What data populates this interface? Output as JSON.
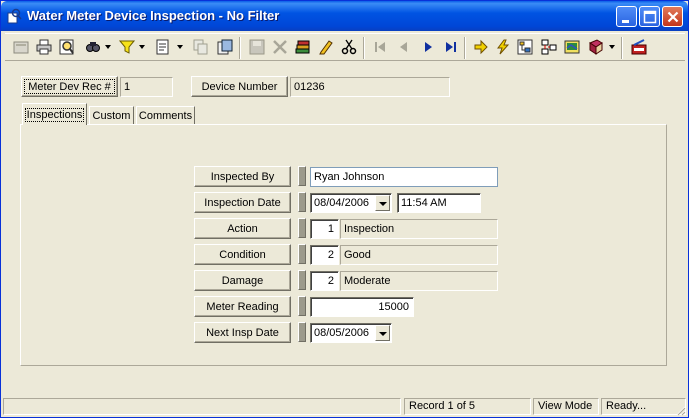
{
  "window": {
    "title": "Water Meter Device Inspection - No Filter"
  },
  "toolbar": {
    "icons": [
      "new-record-icon",
      "print-icon",
      "print-preview-icon",
      "find-icon",
      "filter-icon",
      "report-icon",
      "copy-icon",
      "paste-icon",
      "save-icon",
      "delete-icon",
      "stack-icon",
      "edit-icon",
      "cut-icon",
      "first-record-icon",
      "previous-record-icon",
      "next-record-icon",
      "last-record-icon",
      "jump-icon",
      "lightning-icon",
      "tree-icon",
      "hierarchy-icon",
      "map-icon",
      "book-icon",
      "exit-icon"
    ]
  },
  "header": {
    "rec_label": "Meter Dev Rec #",
    "rec_value": "1",
    "device_label": "Device Number",
    "device_value": "01236"
  },
  "tabs": [
    {
      "label": "Inspections",
      "active": true
    },
    {
      "label": "Custom",
      "active": false
    },
    {
      "label": "Comments",
      "active": false
    }
  ],
  "form": {
    "inspected_by": {
      "label": "Inspected By",
      "value": "Ryan Johnson"
    },
    "inspection_date": {
      "label": "Inspection Date",
      "date": "08/04/2006",
      "time": "11:54 AM"
    },
    "action": {
      "label": "Action",
      "code": "1",
      "desc": "Inspection"
    },
    "condition": {
      "label": "Condition",
      "code": "2",
      "desc": "Good"
    },
    "damage": {
      "label": "Damage",
      "code": "2",
      "desc": "Moderate"
    },
    "meter_reading": {
      "label": "Meter Reading",
      "value": "15000"
    },
    "next_insp_date": {
      "label": "Next Insp Date",
      "date": "08/05/2006"
    }
  },
  "status": {
    "record": "Record 1 of 5",
    "mode": "View Mode",
    "state": "Ready..."
  },
  "colors": {
    "title_bar": "#0054e3",
    "window_bg": "#ece9d8",
    "close_button": "#c2351c"
  }
}
